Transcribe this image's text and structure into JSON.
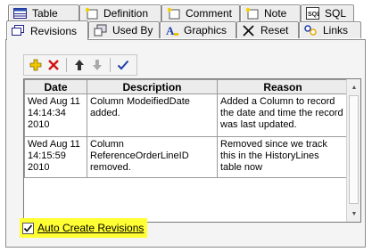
{
  "tabs_top": [
    {
      "label": "Table",
      "icon": "table-icon"
    },
    {
      "label": "Definition",
      "icon": "definition-icon"
    },
    {
      "label": "Comment",
      "icon": "comment-icon"
    },
    {
      "label": "Note",
      "icon": "note-icon"
    },
    {
      "label": "SQL",
      "icon": "sql-icon"
    }
  ],
  "tabs_bottom": [
    {
      "label": "Revisions",
      "icon": "revisions-icon",
      "active": true
    },
    {
      "label": "Used By",
      "icon": "used-by-icon"
    },
    {
      "label": "Graphics",
      "icon": "graphics-icon"
    },
    {
      "label": "Reset",
      "icon": "reset-icon"
    },
    {
      "label": "Links",
      "icon": "links-icon"
    }
  ],
  "toolbar": [
    "add-icon",
    "delete-icon",
    "move-up-icon",
    "move-down-icon",
    "check-icon"
  ],
  "grid": {
    "columns": [
      "Date",
      "Description",
      "Reason"
    ],
    "rows": [
      {
        "date": "Wed Aug 11\n14:14:34\n2010",
        "description": "Column ModeifiedDate added.",
        "reason": "Added a Column to record the date and time the record was last updated."
      },
      {
        "date": "Wed Aug 11\n14:15:59\n2010",
        "description": "Column ReferenceOrderLineID\nremoved.",
        "reason": "Removed since we track\nthis in the HistoryLines\ntable now"
      }
    ]
  },
  "auto_create": {
    "label": "Auto Create Revisions",
    "checked": true
  },
  "colors": {
    "highlight": "#ffff33"
  }
}
